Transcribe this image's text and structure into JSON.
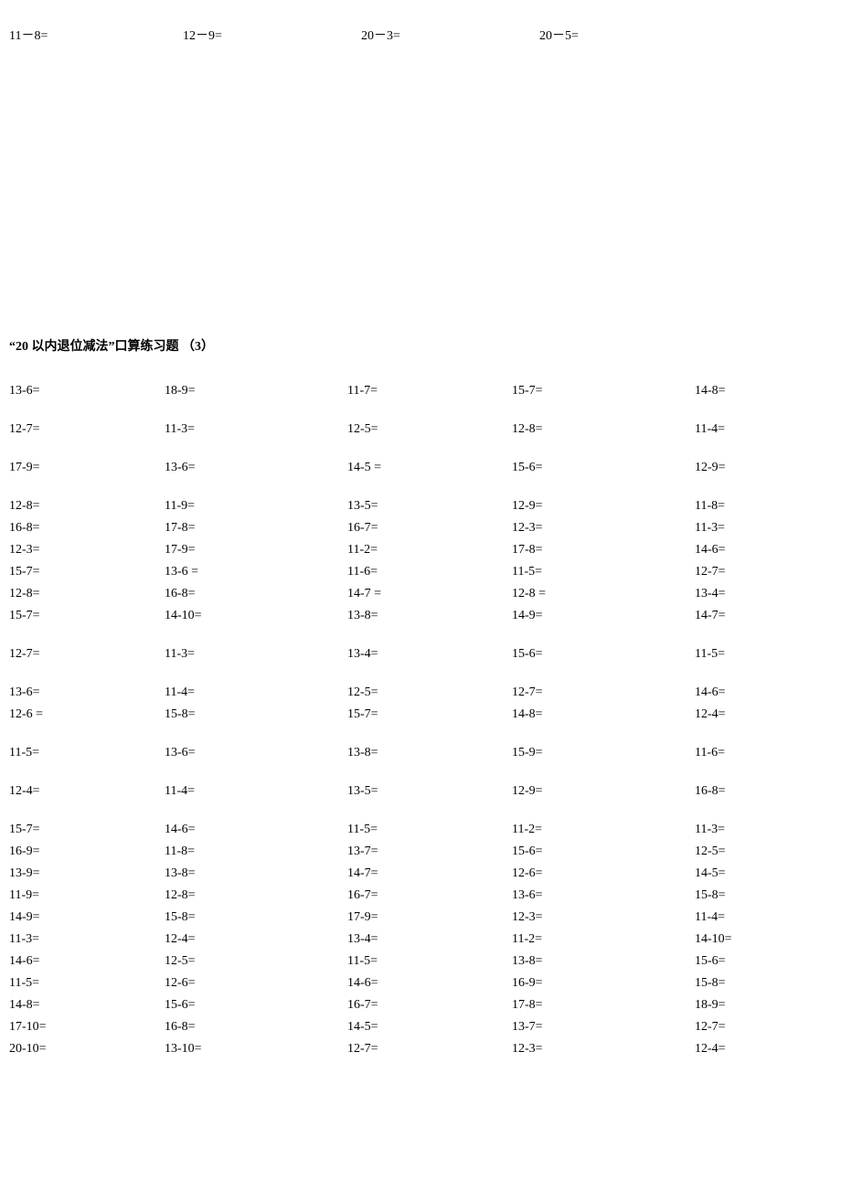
{
  "top_row": [
    "11－8=",
    "12－9=",
    "20－3=",
    "20－5="
  ],
  "section_title": "“20 以内退位减法”口算练习题   （3）",
  "rows": [
    {
      "gap": true,
      "cells": [
        "13-6=",
        "18-9=",
        "11-7=",
        "15-7=",
        "14-8="
      ]
    },
    {
      "gap": true,
      "cells": [
        "12-7=",
        "11-3=",
        "12-5=",
        "12-8=",
        "11-4="
      ]
    },
    {
      "gap": true,
      "cells": [
        "17-9=",
        "13-6=",
        "14-5  =",
        "15-6=",
        "12-9="
      ]
    },
    {
      "gap": false,
      "cells": [
        "12-8=",
        "11-9=",
        "13-5=",
        "12-9=",
        "11-8="
      ]
    },
    {
      "gap": false,
      "cells": [
        "16-8=",
        "17-8=",
        "16-7=",
        "12-3=",
        "11-3="
      ]
    },
    {
      "gap": false,
      "cells": [
        "12-3=",
        "17-9=",
        "11-2=",
        "17-8=",
        "14-6="
      ]
    },
    {
      "gap": false,
      "cells": [
        "15-7=",
        "13-6  =",
        "11-6=",
        "11-5=",
        "12-7="
      ]
    },
    {
      "gap": false,
      "cells": [
        "12-8=",
        "16-8=",
        "14-7  =",
        "12-8  =",
        "13-4="
      ]
    },
    {
      "gap": true,
      "cells": [
        "15-7=",
        "14-10=",
        "13-8=",
        "14-9=",
        "14-7="
      ]
    },
    {
      "gap": true,
      "cells": [
        "12-7=",
        "11-3=",
        "13-4=",
        "15-6=",
        "11-5="
      ]
    },
    {
      "gap": false,
      "cells": [
        "13-6=",
        "11-4=",
        "12-5=",
        "12-7=",
        "14-6="
      ]
    },
    {
      "gap": true,
      "cells": [
        "12-6  =",
        "15-8=",
        "15-7=",
        "14-8=",
        "12-4="
      ]
    },
    {
      "gap": true,
      "cells": [
        "11-5=",
        "13-6=",
        "13-8=",
        "15-9=",
        "11-6="
      ]
    },
    {
      "gap": true,
      "cells": [
        "12-4=",
        "11-4=",
        "13-5=",
        "12-9=",
        "16-8="
      ]
    },
    {
      "gap": false,
      "cells": [
        "15-7=",
        "14-6=",
        "11-5=",
        "11-2=",
        "11-3="
      ]
    },
    {
      "gap": false,
      "cells": [
        "16-9=",
        "11-8=",
        "13-7=",
        "15-6=",
        "12-5="
      ]
    },
    {
      "gap": false,
      "cells": [
        "13-9=",
        "13-8=",
        "14-7=",
        "12-6=",
        "14-5="
      ]
    },
    {
      "gap": false,
      "cells": [
        "11-9=",
        "12-8=",
        "16-7=",
        "13-6=",
        "15-8="
      ]
    },
    {
      "gap": false,
      "cells": [
        "14-9=",
        "15-8=",
        "17-9=",
        "12-3=",
        "11-4="
      ]
    },
    {
      "gap": false,
      "cells": [
        "11-3=",
        "12-4=",
        "13-4=",
        "11-2=",
        "14-10="
      ]
    },
    {
      "gap": false,
      "cells": [
        "14-6=",
        "12-5=",
        "11-5=",
        "13-8=",
        "15-6="
      ]
    },
    {
      "gap": false,
      "cells": [
        "11-5=",
        "12-6=",
        "14-6=",
        "16-9=",
        "15-8="
      ]
    },
    {
      "gap": false,
      "cells": [
        "14-8=",
        "15-6=",
        "16-7=",
        "17-8=",
        "18-9="
      ]
    },
    {
      "gap": false,
      "cells": [
        "17-10=",
        "16-8=",
        "14-5=",
        "13-7=",
        "12-7="
      ]
    },
    {
      "gap": false,
      "cells": [
        "20-10=",
        "13-10=",
        "12-7=",
        "12-3=",
        "12-4="
      ]
    }
  ]
}
